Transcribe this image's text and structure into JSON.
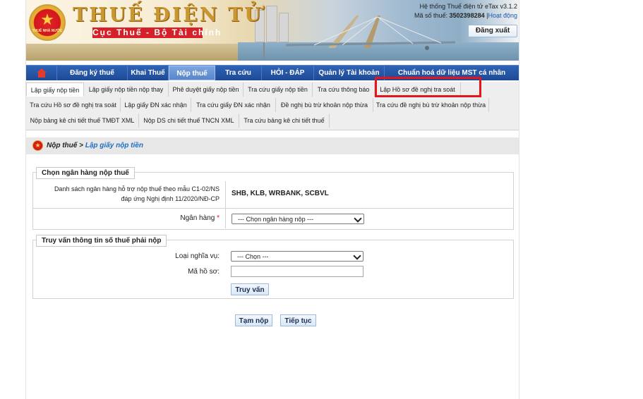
{
  "header": {
    "brand_title": "THUẾ ĐIỆN TỬ",
    "brand_subtitle": "Cục Thuế - Bộ Tài chính",
    "emblem_caption": "THUẾ NHÀ NƯỚC",
    "system_version": "Hệ thống Thuế điện tử eTax v3.1.2",
    "tax_id_label": "Mã số thuế:",
    "tax_id_value": "3502398284",
    "activity_link": "Hoạt động",
    "logout_label": "Đăng xuất"
  },
  "main_nav": {
    "items": [
      {
        "label": "Đăng ký thuế"
      },
      {
        "label": "Khai Thuế"
      },
      {
        "label": "Nộp thuế"
      },
      {
        "label": "Tra cứu"
      },
      {
        "label": "HỎI - ĐÁP"
      },
      {
        "label": "Quản lý Tài khoản"
      },
      {
        "label": "Chuẩn hoá dữ liệu MST cá nhân"
      }
    ],
    "active_index": 2
  },
  "sub_nav": {
    "rows": [
      [
        "Lập giấy nộp tiền",
        "Lập giấy nộp tiền nộp thay",
        "Phê duyệt giấy nộp tiền",
        "Tra cứu giấy nộp tiền",
        "Tra cứu thông báo",
        "Lập Hồ sơ đề nghị tra soát"
      ],
      [
        "Tra cứu Hồ sơ đề nghị tra soát",
        "Lập giấy ĐN xác nhận",
        "Tra cứu giấy ĐN xác nhận",
        "Đề nghị bù trừ khoản nộp thừa",
        "Tra cứu đề nghị bù trừ khoản nộp thừa"
      ],
      [
        "Nộp bảng kê chi tiết thuế TMĐT XML",
        "Nộp DS chi tiết thuế TNCN XML",
        "Tra cứu bảng kê chi tiết thuế"
      ]
    ],
    "highlighted": "Lập Hồ sơ đề nghị tra soát"
  },
  "breadcrumb": {
    "parent": "Nộp thuế",
    "separator": " > ",
    "current": "Lập giấy nộp tiền"
  },
  "bank_section": {
    "legend": "Chọn ngân hàng nộp thuế",
    "supported_label_line1": "Danh sách ngân hàng hỗ trợ nộp thuế theo mẫu C1-02/NS",
    "supported_label_line2": "đáp ứng Nghị định 11/2020/NĐ-CP",
    "supported_banks": "SHB, KLB, WRBANK, SCBVL",
    "bank_label": "Ngân hàng",
    "required_mark": "*",
    "bank_select": "--- Chọn ngân hàng nộp ---"
  },
  "query_section": {
    "legend": "Truy vấn thông tin số thuế phải nộp",
    "obligation_label": "Loại nghĩa vụ:",
    "obligation_select": "--- Chọn ---",
    "record_label": "Mã hồ sơ:",
    "record_value": "",
    "query_button": "Truy vấn"
  },
  "actions": {
    "save_button": "Tạm nộp",
    "continue_button": "Tiếp tục"
  },
  "colors": {
    "nav_blue": "#1d4a96",
    "highlight_red": "#e5161b",
    "link_blue": "#1d6fc5",
    "brand_gold": "#c9962f"
  }
}
